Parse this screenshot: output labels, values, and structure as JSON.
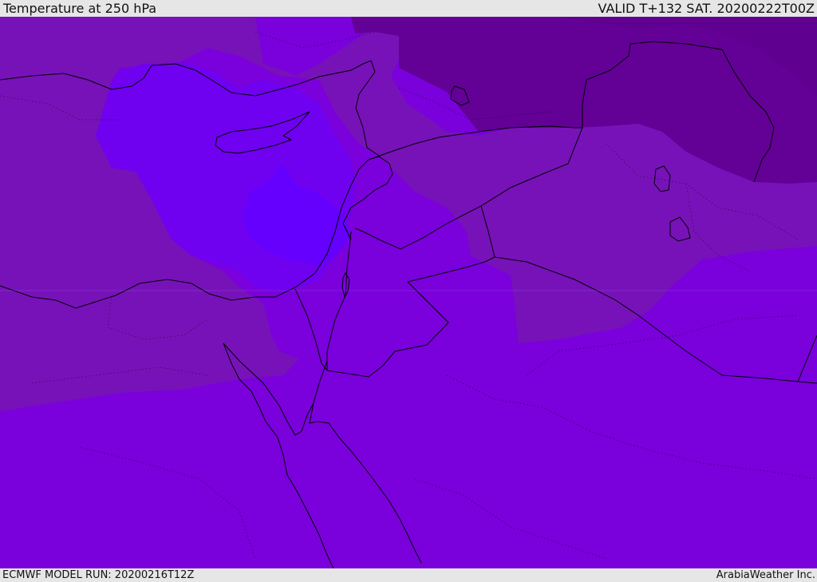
{
  "header": {
    "title": "Temperature at 250 hPa",
    "valid_label": "VALID T+132 SAT. 20200222T00Z"
  },
  "footer": {
    "model_run": "ECMWF MODEL RUN: 20200216T12Z",
    "credit": "ArabiaWeather Inc."
  },
  "colors": {
    "warmest": "#6500ff",
    "warm": "#7600e6",
    "base": "#7a00dc",
    "cool": "#7712b8",
    "cold": "#6c0aa8",
    "coldest": "#630096",
    "lines": "#000000"
  }
}
